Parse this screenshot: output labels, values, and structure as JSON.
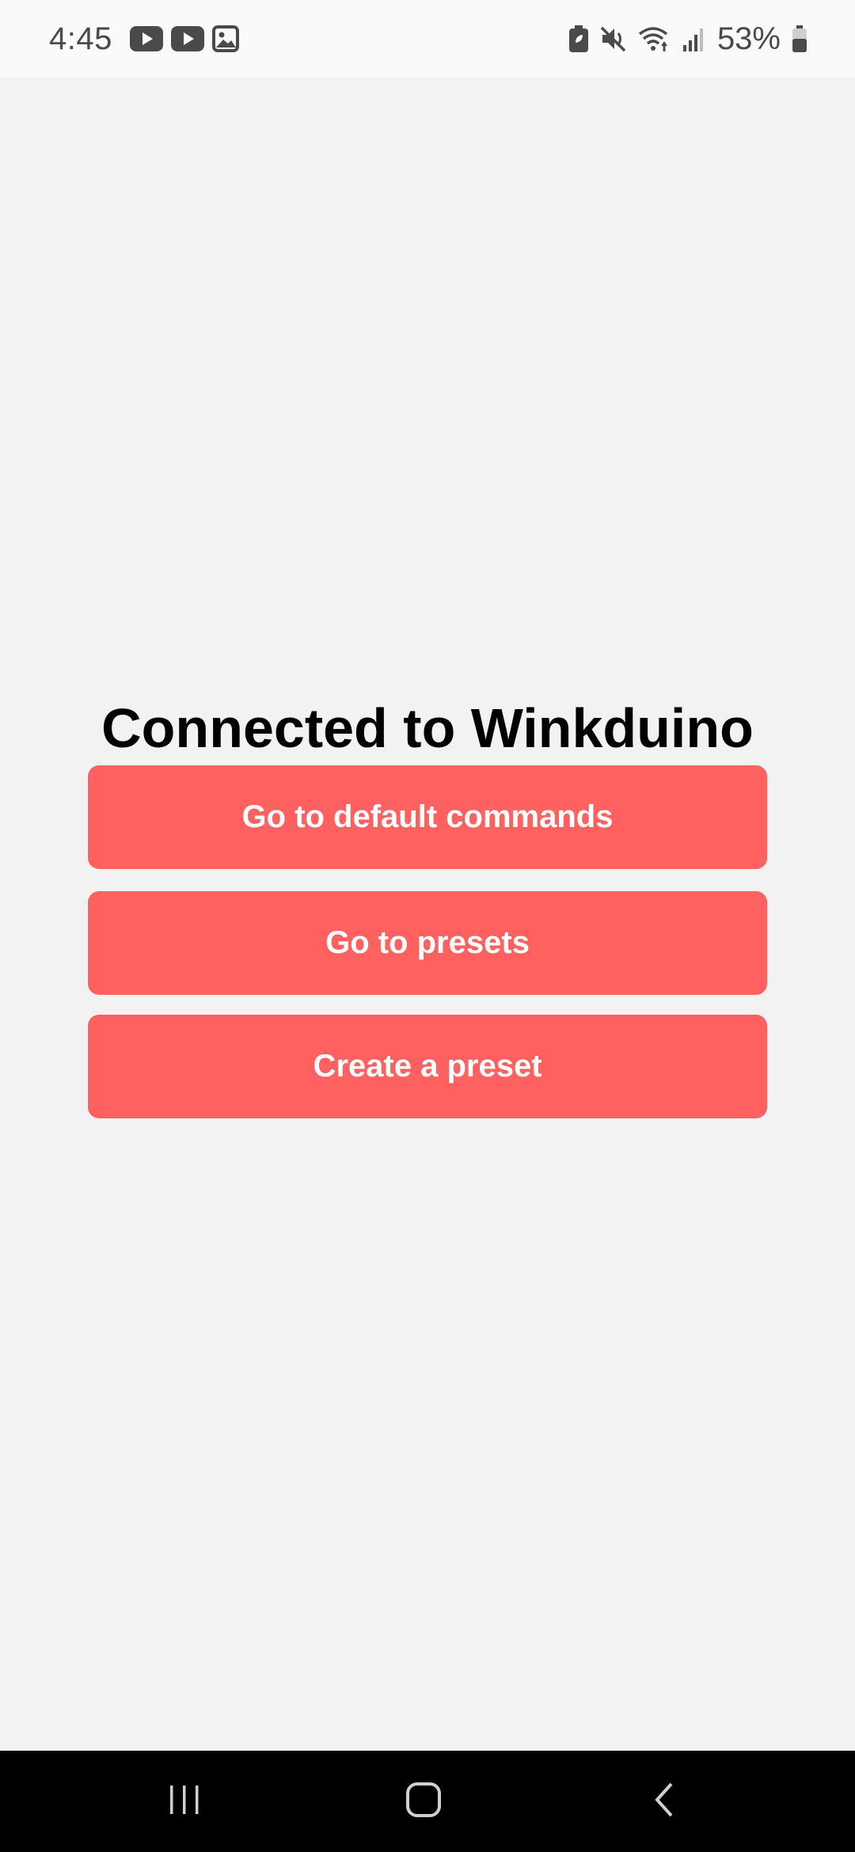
{
  "status_bar": {
    "time": "4:45",
    "battery_percent": "53%",
    "notification_icons": [
      "youtube-icon",
      "youtube-icon",
      "gallery-icon"
    ],
    "system_icons": [
      "battery-saver-icon",
      "mute-icon",
      "wifi-icon",
      "signal-icon",
      "battery-icon"
    ]
  },
  "main": {
    "title": "Connected to Winkduino",
    "buttons": [
      {
        "label": "Go to default commands"
      },
      {
        "label": "Go to presets"
      },
      {
        "label": "Create a preset"
      }
    ]
  },
  "nav_bar": {
    "items": [
      "recents-icon",
      "home-icon",
      "back-icon"
    ]
  },
  "colors": {
    "background": "#f2f2f2",
    "accent": "#ff6060",
    "button_text": "#ffffff",
    "title_text": "#000000",
    "nav_bar": "#000000"
  }
}
